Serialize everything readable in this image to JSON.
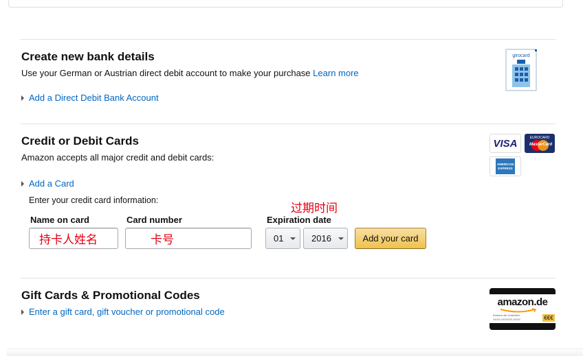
{
  "bank": {
    "title": "Create new bank details",
    "description": "Use your German or Austrian direct debit account to make your purchase",
    "learn_more": "Learn more",
    "add_link": "Add a Direct Debit Bank Account",
    "logo_text": "girocard"
  },
  "cards": {
    "title": "Credit or Debit Cards",
    "description": "Amazon accepts all major credit and debit cards:",
    "add_link": "Add a Card",
    "instructions": "Enter your credit card information:",
    "name_label": "Name on card",
    "name_value": "持卡人姓名",
    "number_label": "Card number",
    "number_value": "卡号",
    "expiration_label": "Expiration date",
    "expiration_annotation": "过期时间",
    "month": "01",
    "year": "2016",
    "add_button": "Add your card",
    "logos": {
      "visa": "VISA",
      "eurocard": "EUROCARD",
      "mastercard": "MasterCard",
      "amex_line1": "AMERICAN",
      "amex_line2": "EXPRESS"
    }
  },
  "gift": {
    "title": "Gift Cards & Promotional Codes",
    "link": "Enter a gift card, gift voucher or promotional code",
    "logo_brand": "amazon.de",
    "logo_label": "Amazon.de Gutschein",
    "logo_code": "XXXX-XXXXXX-XXXX",
    "logo_euro": "€€€"
  },
  "colors": {
    "link": "#0066c0",
    "annotation": "#e60012",
    "button": "#f0c14b"
  }
}
